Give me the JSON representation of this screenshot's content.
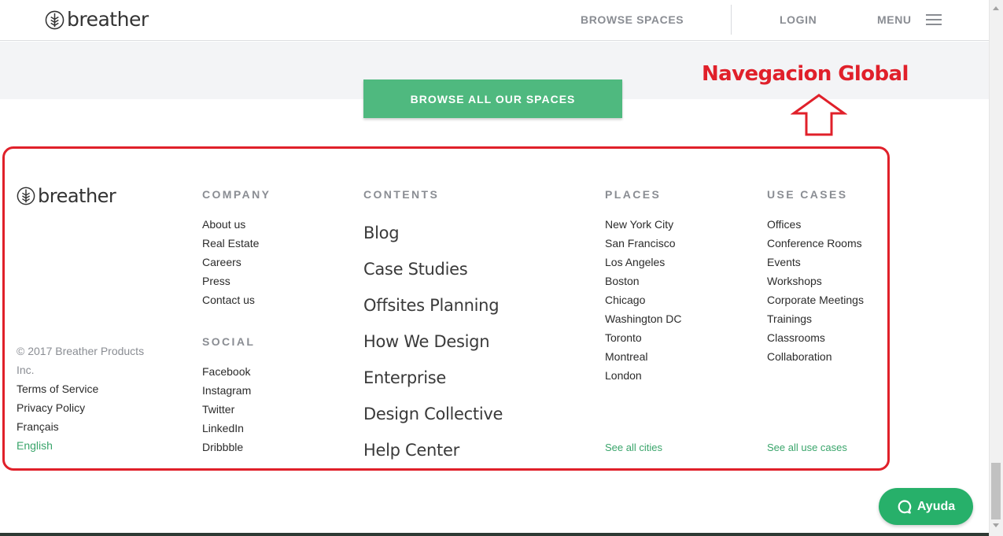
{
  "header": {
    "brand": "breather",
    "browse_spaces": "BROWSE SPACES",
    "login": "LOGIN",
    "menu": "MENU"
  },
  "cta": {
    "label": "BROWSE ALL OUR SPACES"
  },
  "annotation": {
    "label": "Navegacion Global"
  },
  "footer": {
    "brand": "breather",
    "company": {
      "heading": "COMPANY",
      "items": [
        "About us",
        "Real Estate",
        "Careers",
        "Press",
        "Contact us"
      ]
    },
    "social": {
      "heading": "SOCIAL",
      "items": [
        "Facebook",
        "Instagram",
        "Twitter",
        "LinkedIn",
        "Dribbble"
      ]
    },
    "contents": {
      "heading": "CONTENTS",
      "items": [
        "Blog",
        "Case Studies",
        "Offsites Planning",
        "How We Design",
        "Enterprise",
        "Design Collective",
        "Help Center"
      ]
    },
    "places": {
      "heading": "PLACES",
      "items": [
        "New York City",
        "San Francisco",
        "Los Angeles",
        "Boston",
        "Chicago",
        "Washington DC",
        "Toronto",
        "Montreal",
        "London"
      ],
      "see_all": "See all cities"
    },
    "use_cases": {
      "heading": "USE CASES",
      "items": [
        "Offices",
        "Conference Rooms",
        "Events",
        "Workshops",
        "Corporate Meetings",
        "Trainings",
        "Classrooms",
        "Collaboration"
      ],
      "see_all": "See all use cases"
    },
    "legal": {
      "copyright_line1": "© 2017 Breather Products",
      "copyright_line2": "Inc.",
      "terms": "Terms of Service",
      "privacy": "Privacy Policy",
      "lang_fr": "Français",
      "lang_en": "English"
    }
  },
  "chat": {
    "label": "Ayuda"
  },
  "colors": {
    "accent_green": "#4fb97f",
    "link_green": "#3aa56b",
    "annotation_red": "#e0202a",
    "nav_grey": "#8a8d93"
  }
}
